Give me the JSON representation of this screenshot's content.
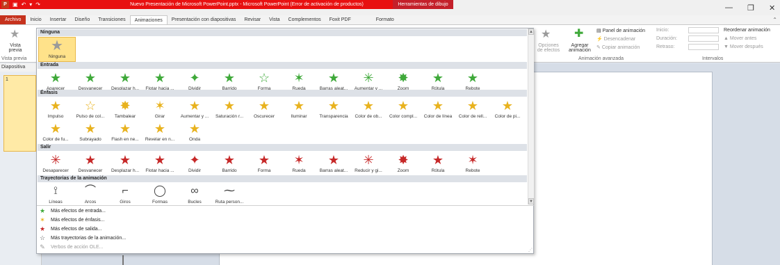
{
  "titlebar": {
    "app_icon": "P",
    "title": "Nuevo Presentación de Microsoft PowerPoint.pptx - Microsoft PowerPoint (Error de activación de productos)",
    "context_tab": "Herramientas de dibujo"
  },
  "tabs": {
    "file": "Archivo",
    "items": [
      "Inicio",
      "Insertar",
      "Diseño",
      "Transiciones",
      "Animaciones",
      "Presentación con diapositivas",
      "Revisar",
      "Vista",
      "Complementos",
      "Foxit PDF"
    ],
    "context": "Formato"
  },
  "ribbon": {
    "preview_label": "Vista previa",
    "preview_group": "Vista previa",
    "effect_options": "Opciones de efectos",
    "add_animation": "Agregar animación",
    "animation_pane": "Panel de animación",
    "trigger": "Desencadenar",
    "copy_animation": "Copiar animación",
    "advanced_group": "Animación avanzada",
    "start": "Inicio:",
    "duration": "Duración:",
    "delay": "Retraso:",
    "reorder": "Reordenar animación",
    "move_earlier": "Mover antes",
    "move_later": "Mover después",
    "timing_group": "Intervalos"
  },
  "leftpane": {
    "header": "Diapositiva",
    "slide_number": "1"
  },
  "gallery": {
    "none_section": "Ninguna",
    "none_item": "Ninguna",
    "entrance_section": "Entrada",
    "entrance": [
      "Aparecer",
      "Desvanecer",
      "Desplazar h...",
      "Flotar hacia ...",
      "Dividir",
      "Barrido",
      "Forma",
      "Rueda",
      "Barras aleat...",
      "Aumentar y ...",
      "Zoom",
      "Rótula",
      "Rebote"
    ],
    "emphasis_section": "Énfasis",
    "emphasis_row1": [
      "Impulso",
      "Pulso de col...",
      "Tambalear",
      "Girar",
      "Aumentar y ...",
      "Saturación r...",
      "Oscurecer",
      "Iluminar",
      "Transparencia",
      "Color de ob...",
      "Color compl...",
      "Color de línea",
      "Color de rell...",
      "Color de pi..."
    ],
    "emphasis_row2": [
      "Color de fu...",
      "Subrayado",
      "Flash en ne...",
      "Revelar en n...",
      "Onda"
    ],
    "exit_section": "Salir",
    "exit": [
      "Desaparecer",
      "Desvanecer",
      "Desplazar h...",
      "Flotar hacia ...",
      "Dividir",
      "Barrido",
      "Forma",
      "Rueda",
      "Barras aleat...",
      "Reducir y gi...",
      "Zoom",
      "Rótula",
      "Rebote"
    ],
    "paths_section": "Trayectorias de la animación",
    "paths": [
      "Líneas",
      "Arcos",
      "Giros",
      "Formas",
      "Bucles",
      "Ruta person..."
    ],
    "more": [
      "Más efectos de entrada...",
      "Más efectos de énfasis...",
      "Más efectos de salida...",
      "Más trayectorias de la animación...",
      "Verbos de acción OLE..."
    ]
  },
  "colors": {
    "entrance": "#3fa93a",
    "emphasis": "#e8b21e",
    "exit": "#c62828",
    "selected": "#ffe28a",
    "file_tab": "#c6321d",
    "titlebar": "#e81010"
  }
}
